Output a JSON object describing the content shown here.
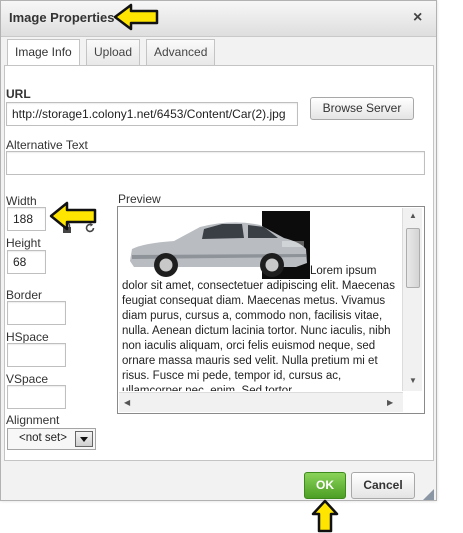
{
  "dialog": {
    "title": "Image Properties",
    "close_label": "×"
  },
  "tabs": [
    {
      "label": "Image Info",
      "active": true
    },
    {
      "label": "Upload",
      "active": false
    },
    {
      "label": "Advanced",
      "active": false
    }
  ],
  "image_info": {
    "url_label": "URL",
    "url_value": "http://storage1.colony1.net/6453/Content/Car(2).jpg",
    "browse_label": "Browse Server",
    "alt_label": "Alternative Text",
    "alt_value": "",
    "width_label": "Width",
    "width_value": "188",
    "height_label": "Height",
    "height_value": "68",
    "border_label": "Border",
    "border_value": "",
    "hspace_label": "HSpace",
    "hspace_value": "",
    "vspace_label": "VSpace",
    "vspace_value": "",
    "alignment_label": "Alignment",
    "alignment_value": "<not set>",
    "preview_label": "Preview",
    "preview_text": "Lorem ipsum dolor sit amet, consectetuer adipiscing elit. Maecenas feugiat consequat diam. Maecenas metus. Vivamus diam purus, cursus a, commodo non, facilisis vitae, nulla. Aenean dictum lacinia tortor. Nunc iaculis, nibh non iaculis aliquam, orci felis euismod neque, sed ornare massa mauris sed velit. Nulla pretium mi et risus. Fusce mi pede, tempor id, cursus ac, ullamcorper nec, enim. Sed tortor."
  },
  "footer": {
    "ok_label": "OK",
    "cancel_label": "Cancel"
  },
  "icons": {
    "lock_ratio": "lock-icon",
    "reset_size": "reset-size-icon",
    "annotation_arrows": "arrow-icon"
  },
  "colors": {
    "ok_button": "#5aad2e",
    "annotation_arrow": "#ffe500"
  }
}
